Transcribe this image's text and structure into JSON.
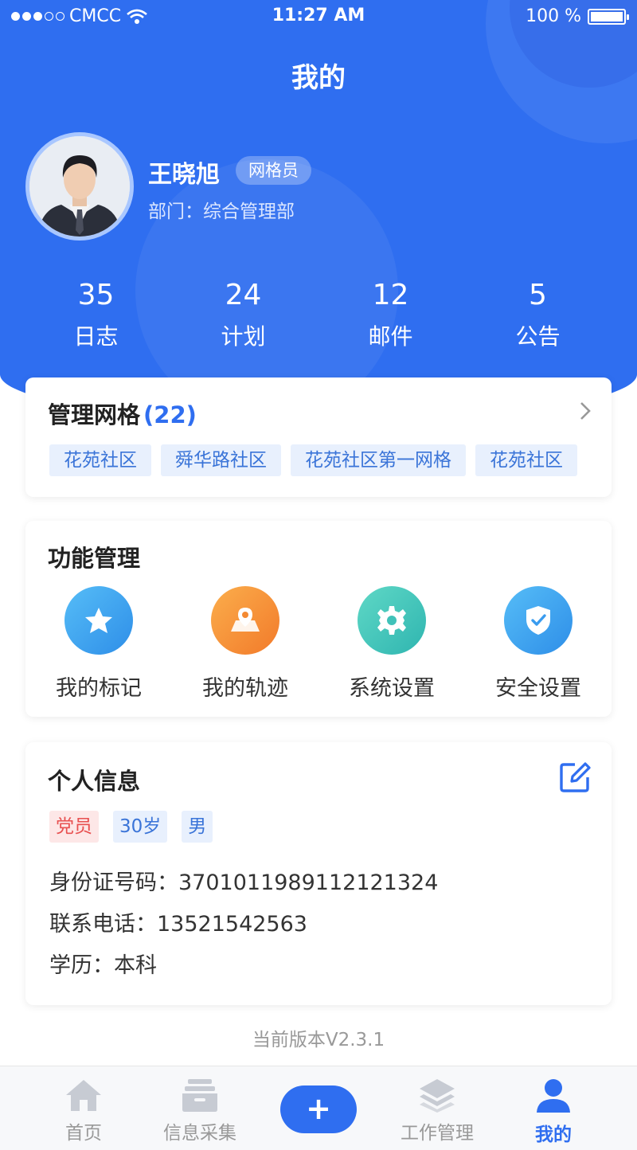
{
  "status_bar": {
    "carrier": "CMCC",
    "time": "11:27 AM",
    "battery": "100 %"
  },
  "page_title": "我的",
  "profile": {
    "name": "王晓旭",
    "role": "网格员",
    "department": "部门：综合管理部"
  },
  "stats": [
    {
      "value": "35",
      "label": "日志"
    },
    {
      "value": "24",
      "label": "计划"
    },
    {
      "value": "12",
      "label": "邮件"
    },
    {
      "value": "5",
      "label": "公告"
    }
  ],
  "grid": {
    "title": "管理网格",
    "count": "(22)",
    "tags": [
      "花苑社区",
      "舜华路社区",
      "花苑社区第一网格",
      "花苑社区"
    ]
  },
  "functions": {
    "title": "功能管理",
    "items": [
      {
        "label": "我的标记",
        "icon": "star-icon",
        "color": "#3aa6f0"
      },
      {
        "label": "我的轨迹",
        "icon": "map-pin-icon",
        "color": "#f7953a"
      },
      {
        "label": "系统设置",
        "icon": "gear-icon",
        "color": "#3fc8b8"
      },
      {
        "label": "安全设置",
        "icon": "shield-check-icon",
        "color": "#3aa6f0"
      }
    ]
  },
  "personal_info": {
    "title": "个人信息",
    "badges": [
      "党员",
      "30岁",
      "男"
    ],
    "id_number": "身份证号码：370101198911212132​4",
    "phone": "联系电话：13521542563",
    "education": "学历：本科"
  },
  "version": "当前版本V2.3.1",
  "tabbar": [
    {
      "label": "首页",
      "icon": "home-icon"
    },
    {
      "label": "信息采集",
      "icon": "inbox-icon"
    },
    {
      "label": "+",
      "icon": "plus-icon"
    },
    {
      "label": "工作管理",
      "icon": "layers-icon"
    },
    {
      "label": "我的",
      "icon": "user-icon"
    }
  ],
  "colors": {
    "primary": "#2f6ef0",
    "tag_bg": "#e8f0fd",
    "party_red": "#e85050"
  }
}
